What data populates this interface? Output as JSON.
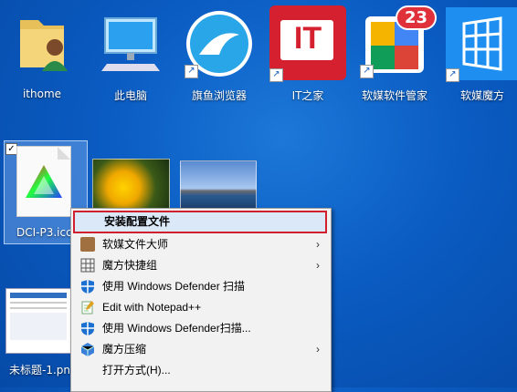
{
  "desktop": {
    "icons": [
      {
        "label": "ithome"
      },
      {
        "label": "此电脑"
      },
      {
        "label": "旗鱼浏览器"
      },
      {
        "label": "IT之家",
        "glyph": "IT"
      },
      {
        "label": "软媒软件管家",
        "badge": "23"
      },
      {
        "label": "软媒魔方"
      }
    ],
    "selected_file": {
      "label": "DCI-P3.icc",
      "checked": "✓"
    },
    "bottom_file": {
      "label": "未标题-1.png"
    }
  },
  "context_menu": {
    "items": [
      {
        "label": "安装配置文件",
        "icon": "none"
      },
      {
        "label": "软媒文件大师",
        "icon": "file-master-icon",
        "submenu": "›"
      },
      {
        "label": "魔方快捷组",
        "icon": "grid-icon",
        "submenu": "›"
      },
      {
        "label": "使用 Windows Defender 扫描",
        "icon": "defender-shield-icon"
      },
      {
        "label": "Edit with Notepad++",
        "icon": "notepad-plus-icon"
      },
      {
        "label": "使用 Windows Defender扫描...",
        "icon": "defender-shield-icon"
      },
      {
        "label": "魔方压缩",
        "icon": "compress-icon",
        "submenu": "›"
      },
      {
        "label": "打开方式(H)...",
        "icon": "none"
      }
    ]
  },
  "colors": {
    "accent": "#d02030",
    "desktop": "#0a5bc2"
  }
}
